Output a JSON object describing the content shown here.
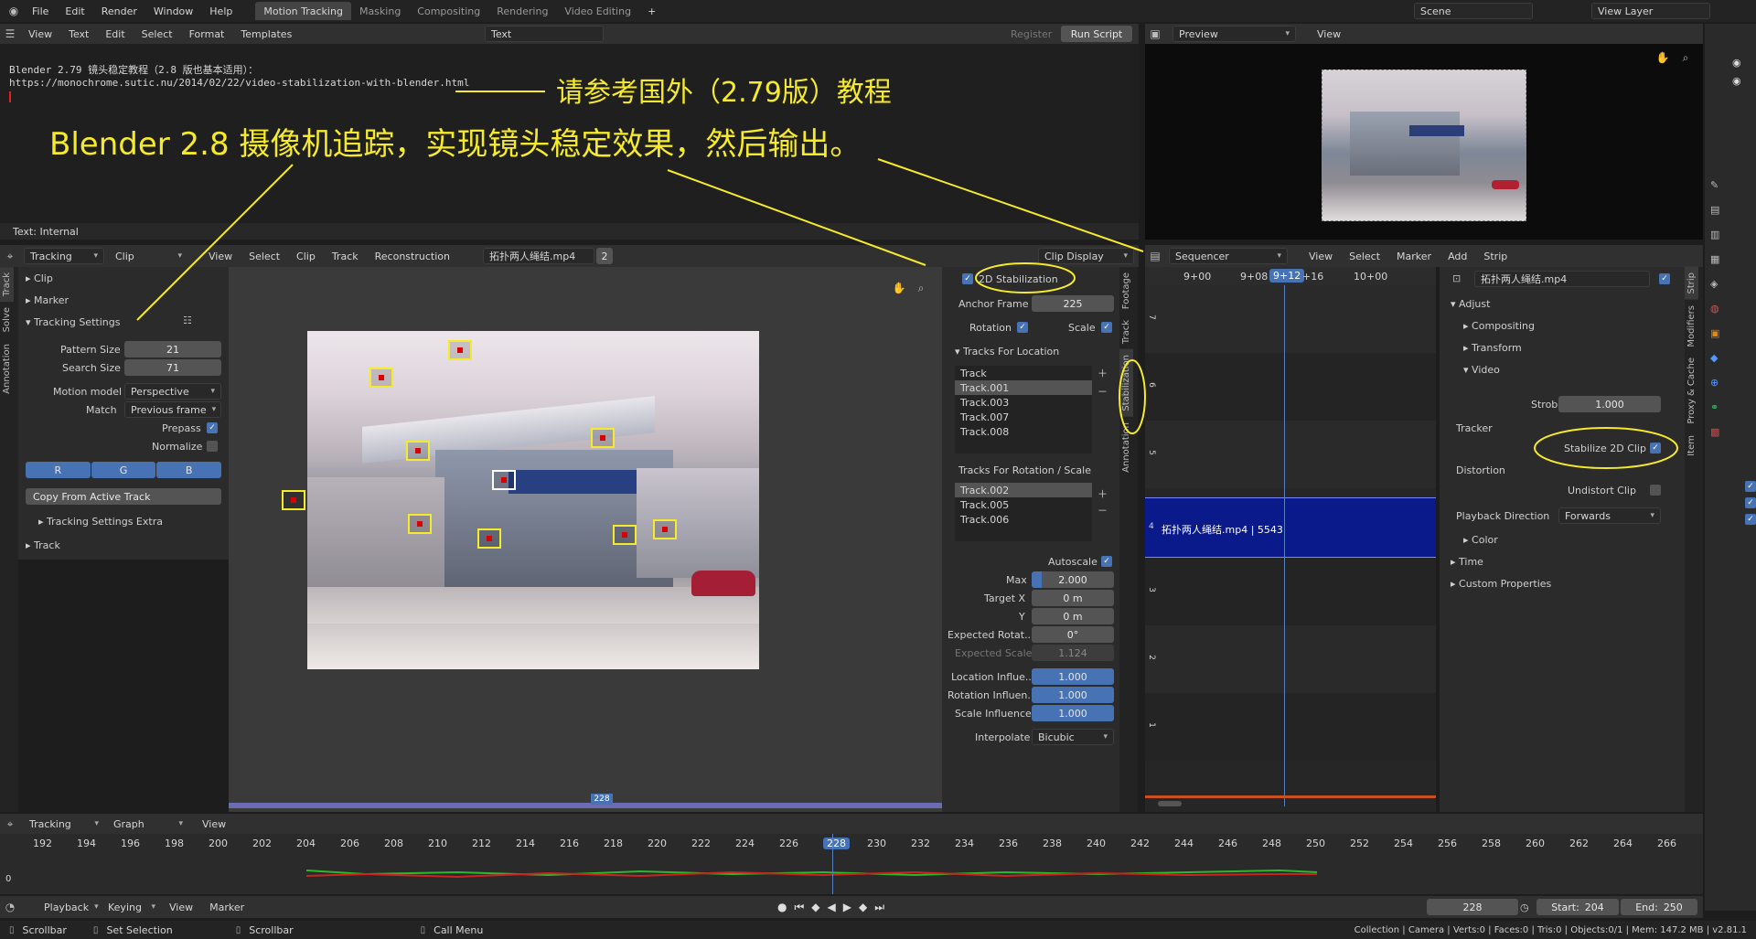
{
  "topbar": {
    "menus": [
      "File",
      "Edit",
      "Render",
      "Window",
      "Help"
    ],
    "workspaces": [
      "Motion Tracking",
      "Masking",
      "Compositing",
      "Rendering",
      "Video Editing"
    ],
    "active_workspace": "Motion Tracking",
    "add_tab": "+",
    "scene": "Scene",
    "view_layer": "View Layer"
  },
  "text_editor": {
    "menus": [
      "View",
      "Text",
      "Edit",
      "Select",
      "Format",
      "Templates"
    ],
    "datablock": "Text",
    "register": "Register",
    "run_script": "Run Script",
    "lines": [
      "Blender 2.79 镜头稳定教程（2.8 版也基本适用）：",
      "https://monochrome.sutic.nu/2014/02/22/video-stabilization-with-blender.html"
    ],
    "status": "Text: Internal"
  },
  "preview": {
    "mode": "Preview",
    "view": "View"
  },
  "clip_editor": {
    "mode": "Tracking",
    "view_type": "Clip",
    "menus": [
      "View",
      "Select",
      "Clip",
      "Track",
      "Reconstruction"
    ],
    "clip_name": "拓扑两人绳结.mp4",
    "users": "2",
    "display": "Clip Display",
    "frame_indicator": "228"
  },
  "left_panel": {
    "tabs": [
      "Track",
      "Solve",
      "Annotation"
    ],
    "sections": {
      "clip": "Clip",
      "marker": "Marker",
      "tracking_settings": "Tracking Settings",
      "track": "Track",
      "extra": "Tracking Settings Extra"
    },
    "pattern_size_label": "Pattern Size",
    "pattern_size": "21",
    "search_size_label": "Search Size",
    "search_size": "71",
    "motion_model_label": "Motion model",
    "motion_model": "Perspective",
    "match_label": "Match",
    "match": "Previous frame",
    "prepass": "Prepass",
    "normalize": "Normalize",
    "channels": [
      "R",
      "G",
      "B"
    ],
    "copy_btn": "Copy From Active Track"
  },
  "stab_panel": {
    "tabs": [
      "Footage",
      "Track",
      "Stabilization",
      "Annotation"
    ],
    "title": "2D Stabilization",
    "anchor_label": "Anchor Frame",
    "anchor": "225",
    "rotation": "Rotation",
    "scale": "Scale",
    "loc_header": "Tracks For Location",
    "loc_tracks": [
      "Track",
      "Track.001",
      "Track.003",
      "Track.007",
      "Track.008"
    ],
    "rot_header": "Tracks For Rotation / Scale",
    "rot_tracks": [
      "Track.002",
      "Track.005",
      "Track.006"
    ],
    "autoscale": "Autoscale",
    "max_label": "Max",
    "max": "2.000",
    "targetx_label": "Target X",
    "targetx": "0 m",
    "y_label": "Y",
    "y": "0 m",
    "exp_rot_label": "Expected Rotat...",
    "exp_rot": "0°",
    "exp_scale_label": "Expected Scale",
    "exp_scale": "1.124",
    "loc_inf_label": "Location Influe...",
    "loc_inf": "1.000",
    "rot_inf_label": "Rotation Influen...",
    "rot_inf": "1.000",
    "scale_inf_label": "Scale Influence",
    "scale_inf": "1.000",
    "interp_label": "Interpolate",
    "interp": "Bicubic"
  },
  "sequencer": {
    "mode": "Sequencer",
    "menus": [
      "View",
      "Select",
      "Marker",
      "Add",
      "Strip"
    ],
    "time_labels": [
      "9+00",
      "9+08",
      "9+12",
      "+16",
      "10+00"
    ],
    "current": "9+12",
    "channels": [
      "7",
      "6",
      "5",
      "4",
      "3",
      "2",
      "1"
    ],
    "strip_label": "拓扑两人绳结.mp4 | 5543"
  },
  "strip_panel": {
    "name": "拓扑两人绳结.mp4",
    "tabs": [
      "Strip",
      "Modifiers",
      "Proxy & Cache",
      "Item"
    ],
    "adjust": "Adjust",
    "compositing": "Compositing",
    "transform": "Transform",
    "video": "Video",
    "strobe_label": "Strobe",
    "strobe": "1.000",
    "tracker": "Tracker",
    "stab_clip": "Stabilize 2D Clip",
    "distortion": "Distortion",
    "undistort": "Undistort Clip",
    "playback_label": "Playback Direction",
    "playback": "Forwards",
    "color": "Color",
    "time": "Time",
    "custom": "Custom Properties"
  },
  "graph_editor": {
    "mode": "Tracking",
    "view_type": "Graph",
    "view": "View",
    "frames": [
      "192",
      "194",
      "196",
      "198",
      "200",
      "202",
      "204",
      "206",
      "208",
      "210",
      "212",
      "214",
      "216",
      "218",
      "220",
      "222",
      "224",
      "226",
      "228",
      "230",
      "232",
      "234",
      "236",
      "238",
      "240",
      "242",
      "244",
      "246",
      "248",
      "250",
      "252",
      "254",
      "256",
      "258",
      "260",
      "262",
      "264",
      "266"
    ],
    "current": "228",
    "zero": "0"
  },
  "timeline": {
    "playback": "Playback",
    "keying": "Keying",
    "view": "View",
    "marker": "Marker",
    "frame": "228",
    "start_label": "Start:",
    "start": "204",
    "end_label": "End:",
    "end": "250"
  },
  "statusbar": {
    "items": [
      "Scrollbar",
      "Set Selection",
      "Scrollbar",
      "Call Menu"
    ],
    "info": "Collection | Camera | Verts:0 | Faces:0 | Tris:0 | Objects:0/1 | Mem: 147.2 MB | v2.81.1"
  },
  "annotations": {
    "line1": "请参考国外（2.79版）教程",
    "line2": "Blender 2.8 摄像机追踪，实现镜头稳定效果，然后输出。"
  },
  "colors": {
    "accent": "#4772b3",
    "annotation": "#f5ea2b",
    "strip": "#0b1a8a"
  }
}
